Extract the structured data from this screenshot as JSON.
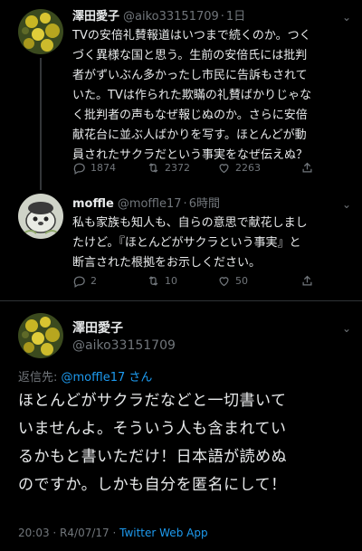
{
  "tweet1": {
    "name": "澤田愛子",
    "handle": "@aiko33151709",
    "time": "1日",
    "lines": [
      "TVの安倍礼賛報道はいつまで続くのか。つく",
      "づく異様な国と思う。生前の安倍氏には批判",
      "者がずいぶん多かったし市民に告訴もされて",
      "いた。TVは作られた欺瞞の礼賛ばかりじゃな",
      "く批判者の声もなぜ報じぬのか。さらに安倍",
      "献花台に並ぶ人ばかりを写す。ほとんどが動",
      "員されたサクラだという事実をなぜ伝えぬ？"
    ],
    "replies": "1874",
    "retweets": "2372",
    "likes": "2263"
  },
  "tweet2": {
    "name": "moffle",
    "handle": "@moffle17",
    "time": "6時間",
    "lines": [
      "私も家族も知人も、自らの意思で献花しまし",
      "たけど。『ほとんどがサクラという事実』と",
      "断言された根拠をお示しください。"
    ],
    "replies": "2",
    "retweets": "10",
    "likes": "50"
  },
  "main": {
    "name": "澤田愛子",
    "handle": "@aiko33151709",
    "replying_prefix": "返信先: ",
    "replying_mention": "@moffle17",
    "replying_suffix": " さん",
    "lines": [
      "ほとんどがサクラだなどと一切書いて",
      "いませんよ。そういう人も含まれてい",
      "るかもと書いただけ！日本語が読めぬ",
      "のですか。しかも自分を匿名にして！"
    ],
    "meta_time": "20:03",
    "meta_date": "R4/07/17",
    "meta_app": "Twitter Web App"
  },
  "icons": [
    "reply-icon",
    "retweet-icon",
    "like-icon",
    "share-icon",
    "caret-down-icon"
  ],
  "colors": {
    "background": "#000000",
    "text": "#e7e9ea",
    "muted": "#71767b",
    "link": "#1d9bf0"
  }
}
